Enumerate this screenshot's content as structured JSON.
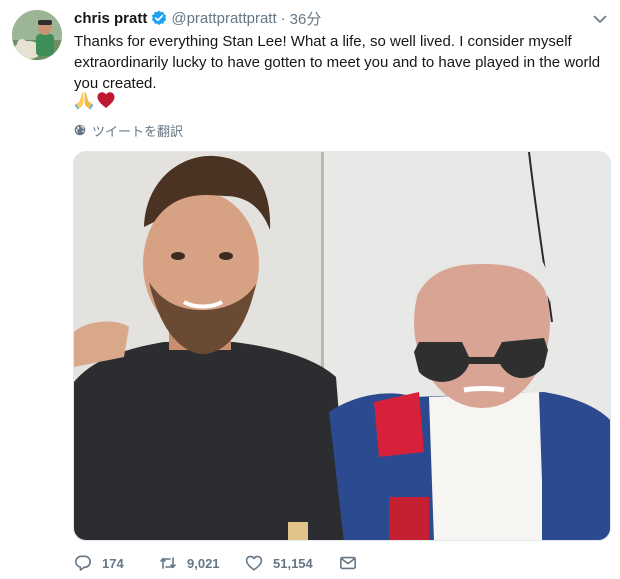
{
  "tweet": {
    "author_name": "chris pratt",
    "handle": "@prattprattpratt",
    "separator": "·",
    "time": "36分",
    "text": "Thanks for everything Stan Lee! What a life, so well lived. I consider myself extraordinarily lucky to have gotten to meet you and to have played in the world you created.",
    "emoji": [
      "🙏",
      "❤️"
    ],
    "translate_label": "ツイートを翻訳"
  },
  "icons": {
    "verified": "verified-badge-icon",
    "caret": "chevron-down-icon",
    "globe": "globe-icon",
    "reply": "reply-icon",
    "retweet": "retweet-icon",
    "like": "heart-icon",
    "dm": "envelope-icon"
  },
  "actions": {
    "replies": "174",
    "retweets": "9,021",
    "likes": "51,154"
  },
  "colors": {
    "text": "#14171a",
    "secondary": "#657786",
    "verified": "#1da1f2",
    "heart": "#e0245e"
  }
}
